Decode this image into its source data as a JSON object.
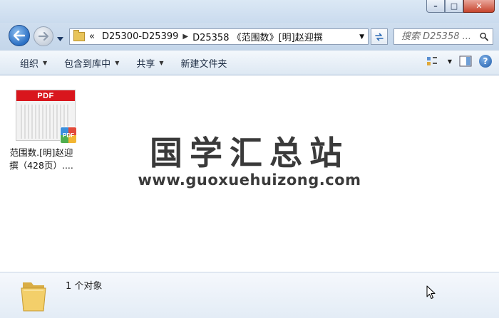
{
  "window": {
    "caption_buttons": {
      "minimize": "–",
      "maximize": "□",
      "close": "✕"
    },
    "colors": {
      "accent": "#2a6fc4",
      "close": "#c7442d",
      "pdf_red": "#d9161d"
    }
  },
  "address_bar": {
    "overflow_chevron": "«",
    "crumbs": [
      "D25300-D25399",
      "D25358 《范围数》[明]赵迎撰"
    ],
    "separator": "▶",
    "dropdown": "▼"
  },
  "search": {
    "placeholder": "搜索 D25358 ..."
  },
  "toolbar": {
    "organize": "组织",
    "include_in_library": "包含到库中",
    "share": "共享",
    "new_folder": "新建文件夹",
    "caret": "▼",
    "help": "?"
  },
  "file": {
    "badge": "PDF",
    "corner_badge": "PDF",
    "name_line1": "范围数.[明]赵迎",
    "name_line2": "撰（428页）...."
  },
  "watermark": {
    "title": "国学汇总站",
    "url": "www.guoxuehuizong.com"
  },
  "details": {
    "status": "1 个对象"
  }
}
